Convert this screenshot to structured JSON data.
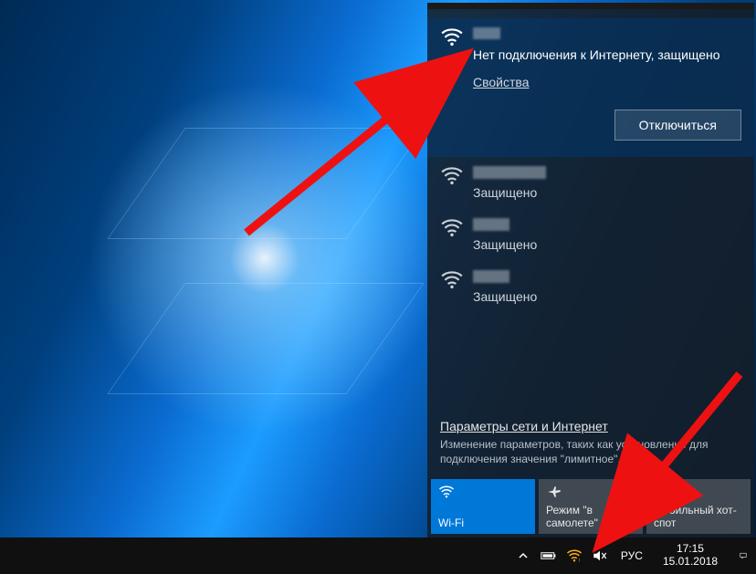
{
  "flyout": {
    "active_network": {
      "status": "Нет подключения к Интернету, защищено",
      "properties_label": "Свойства",
      "disconnect_label": "Отключиться"
    },
    "other_networks": [
      {
        "secured_label": "Защищено"
      },
      {
        "secured_label": "Защищено"
      },
      {
        "secured_label": "Защищено"
      }
    ],
    "settings": {
      "link": "Параметры сети и Интернет",
      "description": "Изменение параметров, таких как установление для подключения значения \"лимитное\"."
    },
    "tiles": {
      "wifi": "Wi-Fi",
      "airplane": "Режим \"в самолете\"",
      "hotspot": "Мобильный хот-спот"
    }
  },
  "taskbar": {
    "language": "РУС",
    "time": "17:15",
    "date": "15.01.2018"
  }
}
